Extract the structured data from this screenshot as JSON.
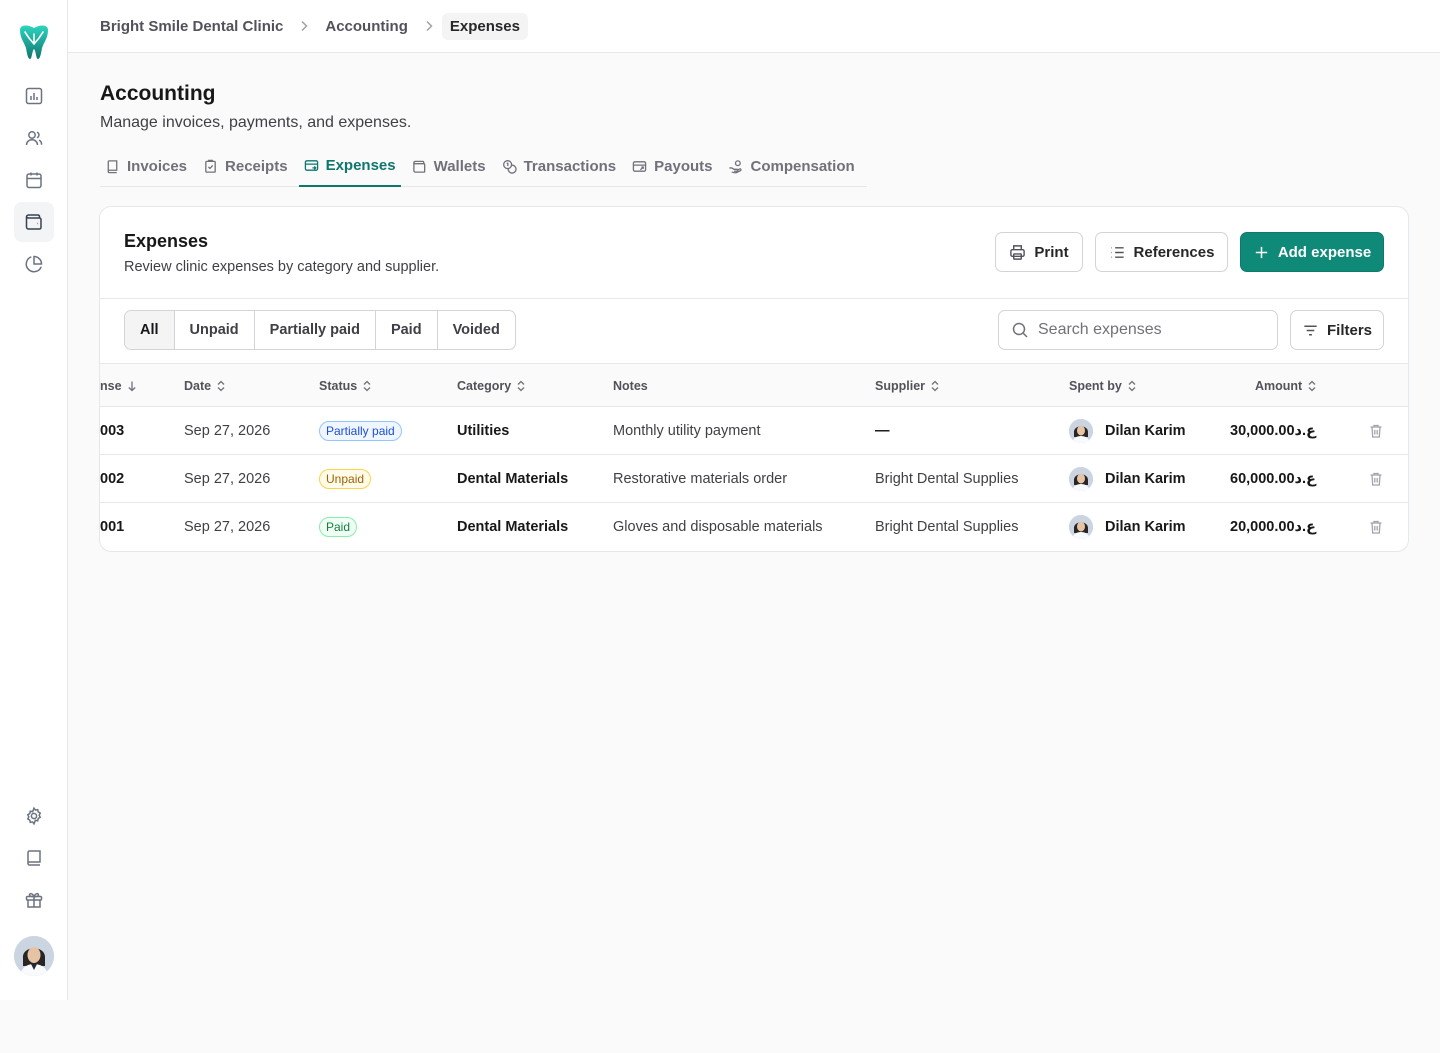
{
  "breadcrumb": [
    "Bright Smile Dental Clinic",
    "Accounting",
    "Expenses"
  ],
  "sidebar": {
    "logo": "tooth-logo",
    "nav_icons": [
      "bar-chart-icon",
      "users-icon",
      "calendar-icon",
      "wallet-icon",
      "pie-chart-icon"
    ],
    "bottom_icons": [
      "settings-icon",
      "book-icon",
      "gift-icon"
    ],
    "active": "wallet-icon"
  },
  "page": {
    "title": "Accounting",
    "subtitle": "Manage invoices, payments, and expenses."
  },
  "tabs": [
    {
      "label": "Invoices",
      "icon": "book-icon"
    },
    {
      "label": "Receipts",
      "icon": "clipboard-check-icon"
    },
    {
      "label": "Expenses",
      "icon": "card-icon",
      "active": true
    },
    {
      "label": "Wallets",
      "icon": "wallet-icon"
    },
    {
      "label": "Transactions",
      "icon": "coins-icon"
    },
    {
      "label": "Payouts",
      "icon": "card-out-icon"
    },
    {
      "label": "Compensation",
      "icon": "hand-coins-icon"
    }
  ],
  "card": {
    "title": "Expenses",
    "subtitle": "Review clinic expenses by category and supplier.",
    "print_label": "Print",
    "references_label": "References",
    "add_label": "Add expense"
  },
  "filters": {
    "status_options": [
      "All",
      "Unpaid",
      "Partially paid",
      "Paid",
      "Voided"
    ],
    "selected": "All",
    "search_placeholder": "Search expenses",
    "filters_label": "Filters"
  },
  "table": {
    "columns": {
      "expense": "nse",
      "date": "Date",
      "status": "Status",
      "category": "Category",
      "notes": "Notes",
      "supplier": "Supplier",
      "spent_by": "Spent by",
      "amount": "Amount"
    },
    "rows": [
      {
        "id": "003",
        "date": "Sep 27, 2026",
        "status": "Partially paid",
        "status_type": "partial",
        "category": "Utilities",
        "notes": "Monthly utility payment",
        "supplier": "—",
        "spent_by": "Dilan Karim",
        "amount": "30,000.00ع.د"
      },
      {
        "id": "002",
        "date": "Sep 27, 2026",
        "status": "Unpaid",
        "status_type": "unpaid",
        "category": "Dental Materials",
        "notes": "Restorative materials order",
        "supplier": "Bright Dental Supplies",
        "spent_by": "Dilan Karim",
        "amount": "60,000.00ع.د"
      },
      {
        "id": "001",
        "date": "Sep 27, 2026",
        "status": "Paid",
        "status_type": "paid",
        "category": "Dental Materials",
        "notes": "Gloves and disposable materials",
        "supplier": "Bright Dental Supplies",
        "spent_by": "Dilan Karim",
        "amount": "20,000.00ع.د"
      }
    ]
  },
  "colors": {
    "accent": "#0f8a78",
    "active_tab": "#0f766e"
  }
}
